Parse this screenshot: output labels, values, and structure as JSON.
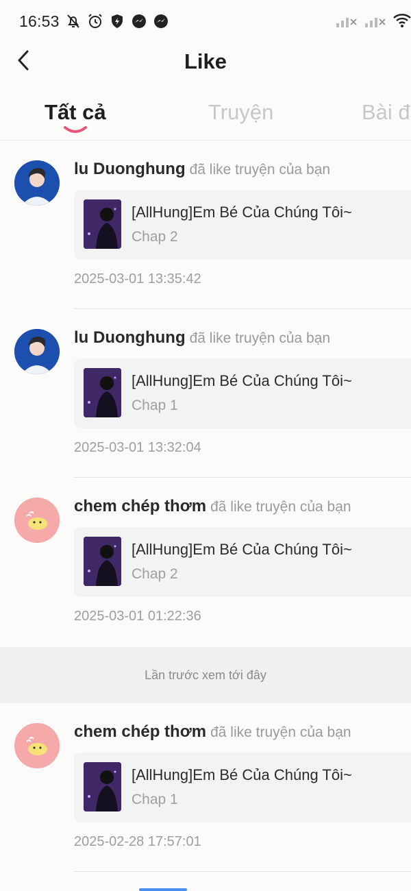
{
  "status_bar": {
    "time": "16:53",
    "left_icons": [
      "bell-off-icon",
      "alarm-icon",
      "shield-icon",
      "messenger-icon",
      "messenger-icon"
    ],
    "right_icons": [
      "signal-off-icon",
      "signal-off-icon",
      "wifi-icon"
    ]
  },
  "header": {
    "title": "Like"
  },
  "tabs": {
    "items": [
      "Tất cả",
      "Truyện",
      "Bài đă"
    ],
    "active_index": 0,
    "indicator_color": "#e8537a"
  },
  "notifications": [
    {
      "user": "lu Duonghung",
      "action": "đã like truyện của bạn",
      "avatar": "boy-portrait",
      "story_title": "[AllHung]Em Bé Của Chúng Tôi~",
      "chapter": "Chap 2",
      "timestamp": "2025-03-01 13:35:42"
    },
    {
      "user": "lu Duonghung",
      "action": "đã like truyện của bạn",
      "avatar": "boy-portrait",
      "story_title": "[AllHung]Em Bé Của Chúng Tôi~",
      "chapter": "Chap 1",
      "timestamp": "2025-03-01 13:32:04"
    },
    {
      "user": "chem chép thơm",
      "action": "đã like truyện của bạn",
      "avatar": "yellow-chick",
      "story_title": "[AllHung]Em Bé Của Chúng Tôi~",
      "chapter": "Chap 2",
      "timestamp": "2025-03-01 01:22:36"
    },
    {
      "user": "chem chép thơm",
      "action": "đã like truyện của bạn",
      "avatar": "yellow-chick",
      "story_title": "[AllHung]Em Bé Của Chúng Tôi~",
      "chapter": "Chap 1",
      "timestamp": "2025-02-28 17:57:01"
    }
  ],
  "last_seen_label": "Lần trước xem tới đây",
  "colors": {
    "background": "#fcfbf9",
    "card": "#f3f3f3",
    "muted_text": "#9e9e9e",
    "accent": "#e8537a"
  }
}
